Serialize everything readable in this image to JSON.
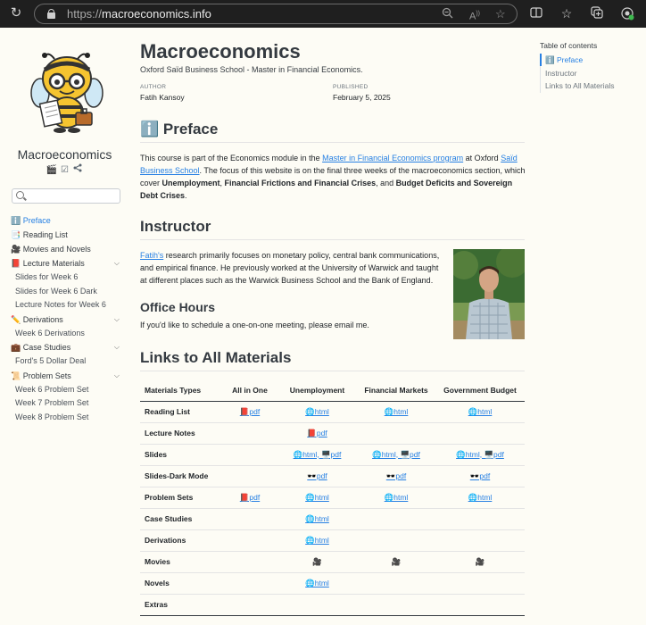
{
  "browser": {
    "url_protocol": "https://",
    "url_host": "macroeconomics.info"
  },
  "site": {
    "title": "Macroeconomics"
  },
  "search": {
    "placeholder": ""
  },
  "nav": {
    "items": [
      {
        "label": "ℹ️ Preface",
        "active": true,
        "chevron": false,
        "sub": false
      },
      {
        "label": "📑 Reading List",
        "active": false,
        "chevron": false,
        "sub": false
      },
      {
        "label": "🎥 Movies and Novels",
        "active": false,
        "chevron": false,
        "sub": false
      },
      {
        "label": "📕 Lecture Materials",
        "active": false,
        "chevron": true,
        "sub": false
      },
      {
        "label": "Slides for Week 6",
        "active": false,
        "chevron": false,
        "sub": true
      },
      {
        "label": "Slides for Week 6 Dark",
        "active": false,
        "chevron": false,
        "sub": true
      },
      {
        "label": "Lecture Notes for Week 6",
        "active": false,
        "chevron": false,
        "sub": true
      },
      {
        "label": "✏️ Derivations",
        "active": false,
        "chevron": true,
        "sub": false
      },
      {
        "label": "Week 6 Derivations",
        "active": false,
        "chevron": false,
        "sub": true
      },
      {
        "label": "💼 Case Studies",
        "active": false,
        "chevron": true,
        "sub": false
      },
      {
        "label": "Ford's 5 Dollar Deal",
        "active": false,
        "chevron": false,
        "sub": true
      },
      {
        "label": "📜 Problem Sets",
        "active": false,
        "chevron": true,
        "sub": false
      },
      {
        "label": "Week 6 Problem Set",
        "active": false,
        "chevron": false,
        "sub": true
      },
      {
        "label": "Week 7 Problem Set",
        "active": false,
        "chevron": false,
        "sub": true
      },
      {
        "label": "Week 8 Problem Set",
        "active": false,
        "chevron": false,
        "sub": true
      }
    ]
  },
  "page": {
    "title": "Macroeconomics",
    "subtitle": "Oxford Saïd Business School - Master in Financial Economics.",
    "author_label": "AUTHOR",
    "author": "Fatih Kansoy",
    "published_label": "PUBLISHED",
    "published": "February 5, 2025"
  },
  "preface": {
    "heading": "ℹ️ Preface",
    "text_1": "This course is part of the Economics module in the ",
    "link_mfe": "Master in Financial Economics program",
    "text_2": " at Oxford ",
    "link_sbs": "Saïd Business School",
    "text_3": ". The focus of this website is on the final three weeks of the macroeconomics section, which cover ",
    "bold_1": "Unemployment",
    "text_4": ", ",
    "bold_2": "Financial Frictions and Financial Crises",
    "text_5": ", and ",
    "bold_3": "Budget Deficits and Sovereign Debt Crises",
    "text_6": "."
  },
  "instructor": {
    "heading": "Instructor",
    "link": "Fatih's",
    "text": " research primarily focuses on monetary policy, central bank communications, and empirical finance. He previously worked at the University of Warwick and taught at different places such as the Warwick Business School and the Bank of England."
  },
  "office_hours": {
    "heading": "Office Hours",
    "text": "If you'd like to schedule a one-on-one meeting, please email me."
  },
  "links": {
    "heading": "Links to All Materials",
    "columns": [
      "Materials Types",
      "All in One",
      "Unemployment",
      "Financial Markets",
      "Government Budget"
    ],
    "rows": [
      [
        "Reading List",
        "📕pdf",
        "🌐html",
        "🌐html",
        "🌐html"
      ],
      [
        "Lecture Notes",
        "",
        "📕pdf",
        "",
        ""
      ],
      [
        "Slides",
        "",
        "🌐html, 🖥️pdf",
        "🌐html, 🖥️pdf",
        "🌐html, 🖥️pdf"
      ],
      [
        "Slides-Dark Mode",
        "",
        "🕶️pdf",
        "🕶️pdf",
        "🕶️pdf"
      ],
      [
        "Problem Sets",
        "📕pdf",
        "🌐html",
        "🌐html",
        "🌐html"
      ],
      [
        "Case Studies",
        "",
        "🌐html",
        "",
        ""
      ],
      [
        "Derivations",
        "",
        "🌐html",
        "",
        ""
      ],
      [
        "Movies",
        "",
        "🎥",
        "🎥",
        "🎥"
      ],
      [
        "Novels",
        "",
        "🌐html",
        "",
        ""
      ],
      [
        "Extras",
        "",
        "",
        "",
        ""
      ]
    ]
  },
  "toc": {
    "title": "Table of contents",
    "items": [
      {
        "label": "ℹ️ Preface",
        "active": true
      },
      {
        "label": "Instructor",
        "active": false
      },
      {
        "label": "Links to All Materials",
        "active": false
      }
    ]
  }
}
